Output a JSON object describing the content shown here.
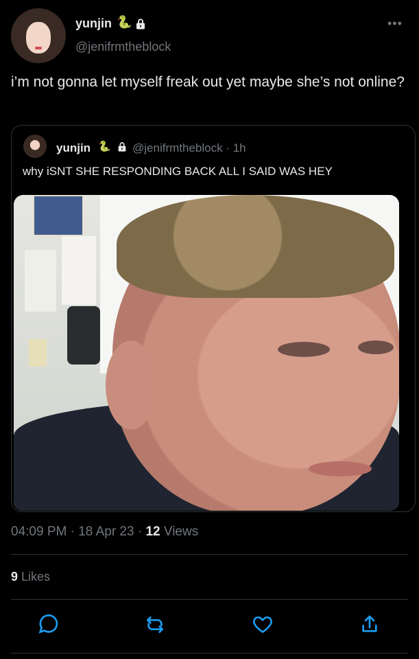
{
  "author": {
    "name": "yunjin",
    "emoji": "🐍",
    "handle": "@jenifrmtheblock",
    "avatar_icon": "profile-photo"
  },
  "tweet": {
    "text": "i’m not gonna let myself freak out yet maybe she’s not online?",
    "time": "04:09 PM",
    "date": "18 Apr 23",
    "views_count": "12",
    "views_label": "Views",
    "likes_count": "9",
    "likes_label": "Likes"
  },
  "quoted": {
    "name": "yunjin",
    "emoji": "🐍",
    "handle_time": "@jenifrmtheblock · 1h",
    "text": "why iSNT SHE RESPONDING BACK ALL I SAID WAS HEY",
    "image_icon": "meme-photo"
  },
  "actions": {
    "reply_icon": "reply-icon",
    "retweet_icon": "retweet-icon",
    "like_icon": "like-icon",
    "share_icon": "share-icon"
  },
  "colors": {
    "background": "#000000",
    "text": "#e7e9ea",
    "muted": "#71767b",
    "border": "#2f3336",
    "accent": "#1d9bf0"
  }
}
